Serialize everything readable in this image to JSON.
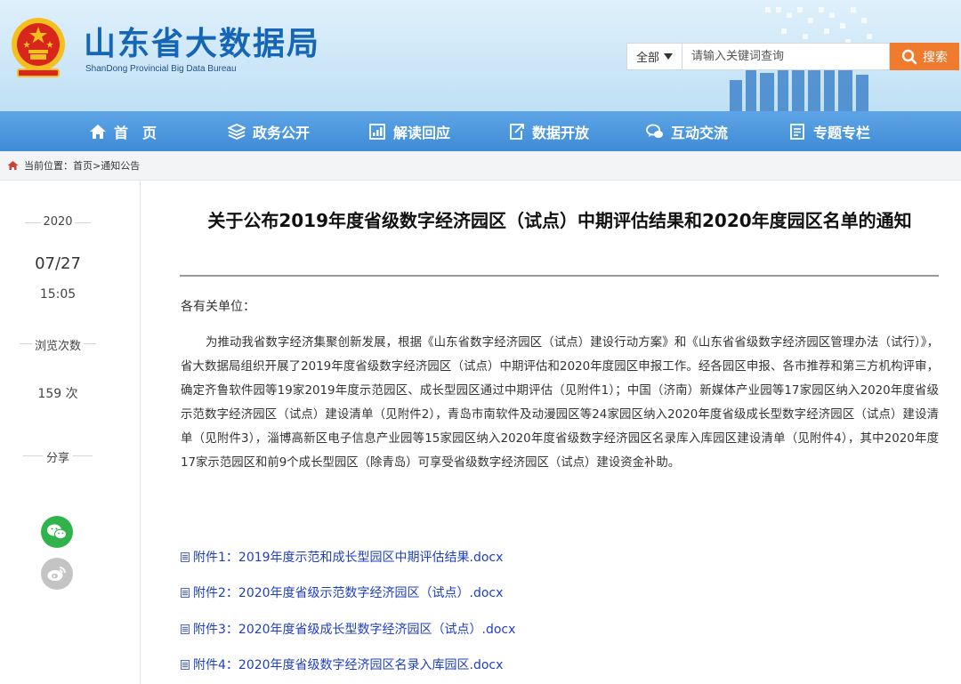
{
  "header": {
    "site_title": "山东省大数据局",
    "site_subtitle": "ShanDong Provincial Big Data Bureau"
  },
  "search": {
    "scope_label": "全部",
    "placeholder": "请输入关键词查询",
    "button_label": "搜索"
  },
  "nav": {
    "items": [
      {
        "label": "首　页",
        "icon": "home-icon"
      },
      {
        "label": "政务公开",
        "icon": "layers-icon"
      },
      {
        "label": "解读回应",
        "icon": "chart-board-icon"
      },
      {
        "label": "数据开放",
        "icon": "export-icon"
      },
      {
        "label": "互动交流",
        "icon": "chat-icon"
      },
      {
        "label": "专题专栏",
        "icon": "document-icon"
      }
    ]
  },
  "breadcrumb": {
    "text": "当前位置：首页>通知公告"
  },
  "sidebar": {
    "year": "2020",
    "date": "07/27",
    "time": "15:05",
    "views_label": "浏览次数",
    "views_value": "159 次",
    "share_label": "分享",
    "share_icons": [
      "wechat-icon",
      "weibo-icon"
    ]
  },
  "article": {
    "title": "关于公布2019年度省级数字经济园区（试点）中期评估结果和2020年度园区名单的通知",
    "greeting": "各有关单位：",
    "body": "为推动我省数字经济集聚创新发展，根据《山东省数字经济园区（试点）建设行动方案》和《山东省省级数字经济园区管理办法（试行）》，省大数据局组织开展了2019年度省级数字经济园区（试点）中期评估和2020年度园区申报工作。经各园区申报、各市推荐和第三方机构评审，确定齐鲁软件园等19家2019年度示范园区、成长型园区通过中期评估（见附件1）；中国（济南）新媒体产业园等17家园区纳入2020年度省级示范数字经济园区（试点）建设清单（见附件2），青岛市南软件及动漫园区等24家园区纳入2020年度省级成长型数字经济园区（试点）建设清单（见附件3），淄博高新区电子信息产业园等15家园区纳入2020年度省级数字经济园区名录库入库园区建设清单（见附件4），其中2020年度17家示范园区和前9个成长型园区（除青岛）可享受省级数字经济园区（试点）建设资金补助。",
    "attachments": [
      "附件1：2019年度示范和成长型园区中期评估结果.docx",
      "附件2：2020年度省级示范数字经济园区（试点）.docx",
      "附件3：2020年度省级成长型数字经济园区（试点）.docx",
      "附件4：2020年度省级数字经济园区名录入库园区.docx"
    ]
  },
  "colors": {
    "brand_blue": "#1566b7",
    "nav_blue": "#3f8bd6",
    "search_orange": "#f07a2e",
    "link_blue": "#1f3fbf",
    "wechat_green": "#2fb34a",
    "weibo_gray": "#c4c4c4"
  }
}
